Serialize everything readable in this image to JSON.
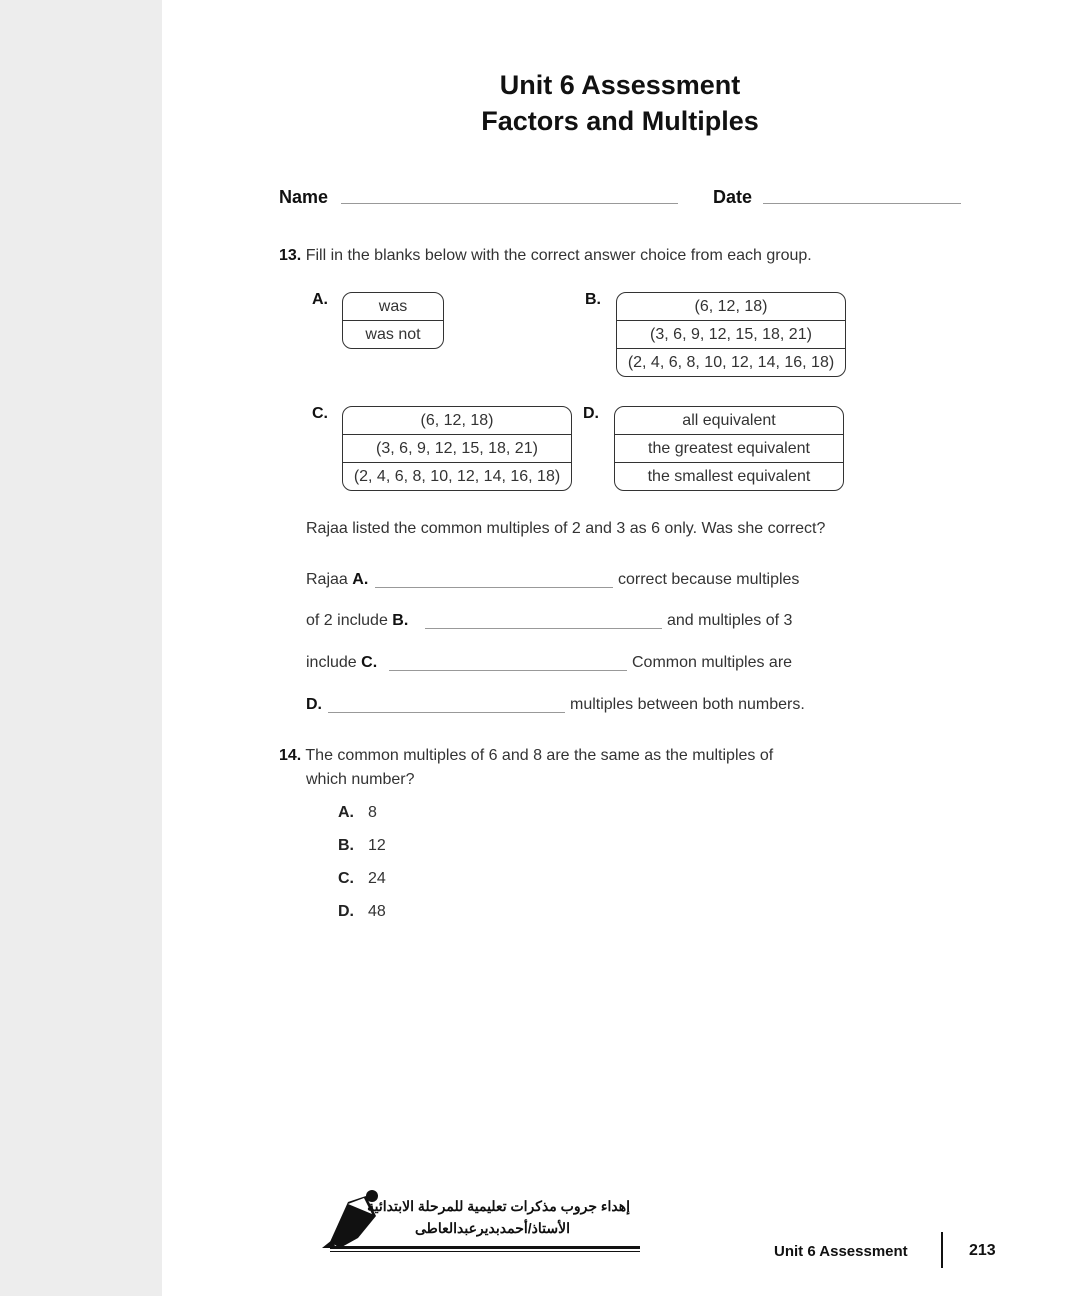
{
  "header": {
    "title_line1": "Unit 6 Assessment",
    "title_line2": "Factors and Multiples",
    "name_label": "Name",
    "date_label": "Date"
  },
  "q13": {
    "number": "13.",
    "prompt": "Fill in the blanks below with the correct answer choice from each group.",
    "groups": {
      "A": {
        "label": "A.",
        "options": [
          "was",
          "was not"
        ]
      },
      "B": {
        "label": "B.",
        "options": [
          "(6, 12, 18)",
          "(3, 6, 9, 12, 15, 18, 21)",
          "(2, 4, 6, 8, 10, 12, 14, 16, 18)"
        ]
      },
      "C": {
        "label": "C.",
        "options": [
          "(6, 12, 18)",
          "(3, 6, 9, 12, 15, 18, 21)",
          "(2, 4, 6, 8, 10, 12, 14, 16, 18)"
        ]
      },
      "D": {
        "label": "D.",
        "options": [
          "all equivalent",
          "the greatest equivalent",
          "the smallest equivalent"
        ]
      }
    },
    "question": "Rajaa listed the common multiples of 2 and 3 as 6 only. Was she correct?",
    "sentence": {
      "line1_pre": "Rajaa",
      "line1_label": "A.",
      "line1_post": "correct because multiples",
      "line2_pre": "of 2 include",
      "line2_label": "B.",
      "line2_post": "and multiples of 3",
      "line3_pre": "include",
      "line3_label": "C.",
      "line3_post": "Common multiples are",
      "line4_label": "D.",
      "line4_post": "multiples between both numbers."
    }
  },
  "q14": {
    "number": "14.",
    "prompt_line1": "The common multiples of 6 and 8 are the same as the multiples of",
    "prompt_line2": "which number?",
    "choices": [
      {
        "letter": "A.",
        "value": "8"
      },
      {
        "letter": "B.",
        "value": "12"
      },
      {
        "letter": "C.",
        "value": "24"
      },
      {
        "letter": "D.",
        "value": "48"
      }
    ]
  },
  "footer": {
    "arabic_line1": "إهداء جروب مذكرات تعليمية للمرحلة الابتدائية",
    "arabic_line2": "الأستاذ/أحمدبديرعبدالعاطى",
    "section": "Unit 6 Assessment",
    "page_number": "213"
  }
}
